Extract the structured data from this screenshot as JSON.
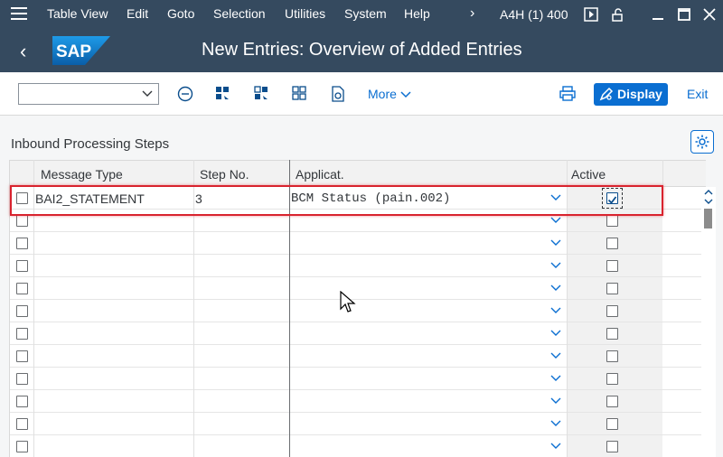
{
  "menu": {
    "items": [
      {
        "label": "Table View"
      },
      {
        "label": "Edit"
      },
      {
        "label": "Goto"
      },
      {
        "label": "Selection"
      },
      {
        "label": "Utilities"
      },
      {
        "label": "System"
      },
      {
        "label": "Help"
      }
    ],
    "system_id": "A4H (1) 400"
  },
  "header": {
    "logo_text": "SAP",
    "title": "New Entries: Overview of Added Entries"
  },
  "toolbar": {
    "dropdown_value": "",
    "more_label": "More",
    "display_label": "Display",
    "exit_label": "Exit"
  },
  "section": {
    "title": "Inbound Processing Steps"
  },
  "table": {
    "columns": [
      "Message Type",
      "Step No.",
      "Applicat.",
      "Active"
    ],
    "rows": [
      {
        "message_type": "BAI2_STATEMENT",
        "step_no": "3",
        "applicat": "BCM Status (pain.002)",
        "active": true,
        "selected": false
      },
      {
        "message_type": "",
        "step_no": "",
        "applicat": "",
        "active": false,
        "selected": false
      },
      {
        "message_type": "",
        "step_no": "",
        "applicat": "",
        "active": false,
        "selected": false
      },
      {
        "message_type": "",
        "step_no": "",
        "applicat": "",
        "active": false,
        "selected": false
      },
      {
        "message_type": "",
        "step_no": "",
        "applicat": "",
        "active": false,
        "selected": false
      },
      {
        "message_type": "",
        "step_no": "",
        "applicat": "",
        "active": false,
        "selected": false
      },
      {
        "message_type": "",
        "step_no": "",
        "applicat": "",
        "active": false,
        "selected": false
      },
      {
        "message_type": "",
        "step_no": "",
        "applicat": "",
        "active": false,
        "selected": false
      },
      {
        "message_type": "",
        "step_no": "",
        "applicat": "",
        "active": false,
        "selected": false
      },
      {
        "message_type": "",
        "step_no": "",
        "applicat": "",
        "active": false,
        "selected": false
      },
      {
        "message_type": "",
        "step_no": "",
        "applicat": "",
        "active": false,
        "selected": false
      },
      {
        "message_type": "",
        "step_no": "",
        "applicat": "",
        "active": false,
        "selected": false
      }
    ]
  },
  "colors": {
    "shell": "#354a5f",
    "accent": "#0a6ed1",
    "highlight": "#d9232e"
  }
}
